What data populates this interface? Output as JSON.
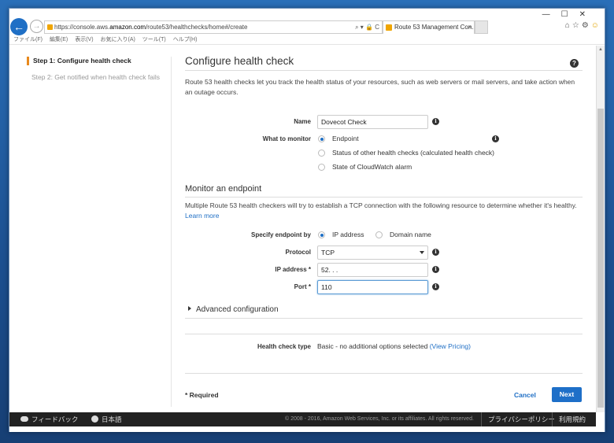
{
  "browser": {
    "url_prefix": "https://console.aws.",
    "url_host": "amazon.com",
    "url_path": "/route53/healthchecks/home#/create",
    "address_tools": "⌕ ▾ 🔒 C",
    "tab_title": "Route 53 Management Con...",
    "tab_close": "×",
    "window_controls": "—☐✕",
    "menu": [
      "ファイル(F)",
      "編集(E)",
      "表示(V)",
      "お気に入り(A)",
      "ツール(T)",
      "ヘルプ(H)"
    ]
  },
  "sidebar": {
    "step1": "Step 1: Configure health check",
    "step2": "Step 2: Get notified when health check fails"
  },
  "main": {
    "title": "Configure health check",
    "description": "Route 53 health checks let you track the health status of your resources, such as web servers or mail servers, and take action when an outage occurs.",
    "name_label": "Name",
    "name_value": "Dovecot Check",
    "monitor_label": "What to monitor",
    "monitor_options": [
      "Endpoint",
      "Status of other health checks (calculated health check)",
      "State of CloudWatch alarm"
    ],
    "endpoint_title": "Monitor an endpoint",
    "endpoint_desc": "Multiple Route 53 health checkers will try to establish a TCP connection with the following resource to determine whether it's healthy.",
    "learn_more": "Learn more",
    "specify_label": "Specify endpoint by",
    "specify_options": [
      "IP address",
      "Domain name"
    ],
    "protocol_label": "Protocol",
    "protocol_value": "TCP",
    "ip_label": "IP address *",
    "ip_value": "52.  .  .  ",
    "port_label": "Port *",
    "port_value": "110",
    "advanced": "Advanced configuration",
    "type_label": "Health check type",
    "type_value": "Basic - no additional options selected",
    "view_pricing": "(View Pricing)",
    "required": "* Required",
    "cancel": "Cancel",
    "next": "Next"
  },
  "footer": {
    "feedback": "フィードバック",
    "language": "日本語",
    "copyright": "© 2008 - 2016, Amazon Web Services, Inc. or its affiliates. All rights reserved.",
    "privacy": "プライバシーポリシー",
    "terms": "利用規約"
  },
  "colors": {
    "accent": "#1e6fc8",
    "step_marker": "#e8891d",
    "footer_bg": "#222222"
  }
}
